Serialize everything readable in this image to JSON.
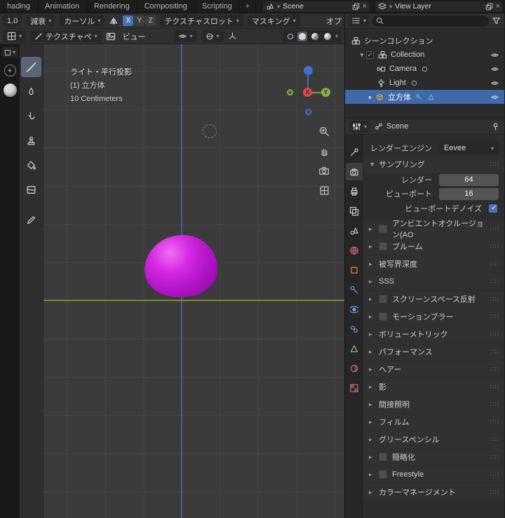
{
  "colors": {
    "accent_blue": "#4772b3",
    "selection_blue": "#3f6aa9",
    "object_purple": "#c31bd8",
    "axis_x_red": "#d94b4b",
    "axis_y_green": "#84b33e",
    "axis_z_blue": "#3f6fd0",
    "floor_line_green": "#7f8f2e"
  },
  "icons": {
    "dropdown": "▾",
    "collapsed": "▸",
    "expanded": "▼",
    "close": "×",
    "plus": "+",
    "grip": "∷∷",
    "check": "✓"
  },
  "topbar": {
    "tabs": [
      {
        "label": "hading"
      },
      {
        "label": "Animation"
      },
      {
        "label": "Rendering"
      },
      {
        "label": "Compositing"
      },
      {
        "label": "Scripting"
      }
    ],
    "add_tab_label": "+",
    "scene_selector": {
      "value": "Scene"
    },
    "view_layer_selector": {
      "value": "View Layer"
    }
  },
  "tool_header": {
    "strength_value": "1.0",
    "falloff_label": "減衰",
    "cursor_label": "カーソル",
    "symmetry": {
      "x": "X",
      "y": "Y",
      "z": "Z"
    },
    "texture_slots_label": "テクスチャスロット",
    "masking_label": "マスキング",
    "options_label": "オプ"
  },
  "viewport_header": {
    "mode_label": "テクスチャペ",
    "view_menu_label": "ビュー"
  },
  "viewport": {
    "view_label": "ライト・平行投影",
    "object_label": "(1) 立方体",
    "unit_label": "10 Centimeters",
    "gizmo": {
      "x_label": "X",
      "y_label": "Y"
    }
  },
  "outliner": {
    "search_value": "",
    "scene_collection_label": "シーンコレクション",
    "items": [
      {
        "label": "Collection"
      },
      {
        "label": "Camera"
      },
      {
        "label": "Light"
      },
      {
        "label": "立方体"
      }
    ]
  },
  "properties": {
    "breadcrumb": "Scene",
    "engine_label": "レンダーエンジン",
    "engine_value": "Eevee",
    "sampling": {
      "title": "サンプリング",
      "render_label": "レンダー",
      "render_value": "64",
      "viewport_label": "ビューポート",
      "viewport_value": "16",
      "denoise_label": "ビューポートデノイズ"
    },
    "sections": [
      {
        "label": "アンビエントオクルージョン(AO"
      },
      {
        "label": "ブルーム"
      },
      {
        "label": "被写界深度"
      },
      {
        "label": "SSS"
      },
      {
        "label": "スクリーンスペース反射"
      },
      {
        "label": "モーションブラー"
      },
      {
        "label": "ボリューメトリック"
      },
      {
        "label": "パフォーマンス"
      },
      {
        "label": "ヘアー"
      },
      {
        "label": "影"
      },
      {
        "label": "間接照明"
      },
      {
        "label": "フィルム"
      },
      {
        "label": "グリースペンシル"
      },
      {
        "label": "簡略化"
      },
      {
        "label": "Freestyle"
      },
      {
        "label": "カラーマネージメント"
      }
    ]
  }
}
